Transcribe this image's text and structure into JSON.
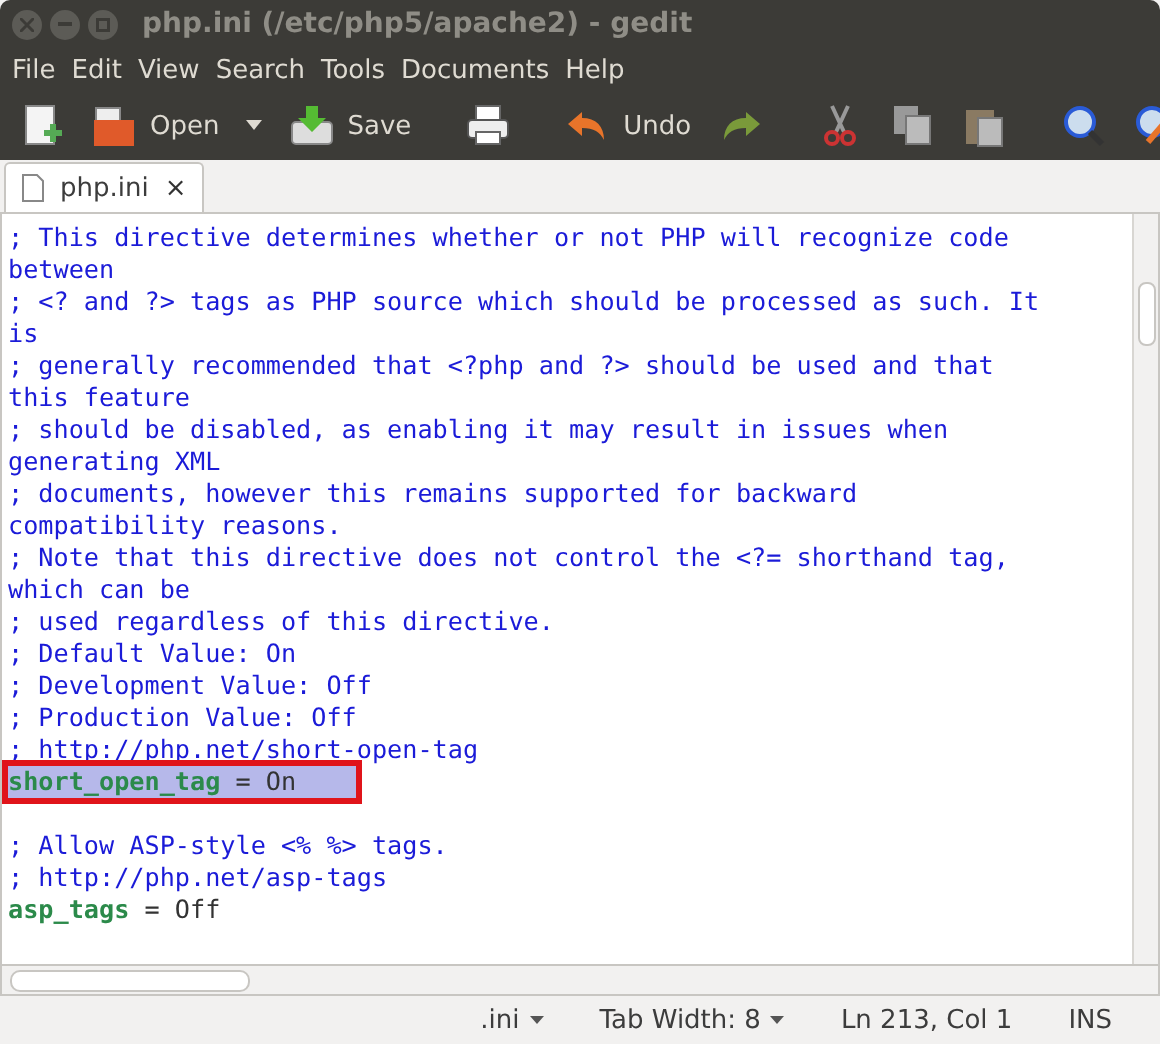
{
  "window": {
    "title": "php.ini (/etc/php5/apache2) - gedit"
  },
  "menu": [
    "File",
    "Edit",
    "View",
    "Search",
    "Tools",
    "Documents",
    "Help"
  ],
  "toolbar": [
    {
      "kind": "new"
    },
    {
      "kind": "open",
      "label": "Open"
    },
    {
      "kind": "dropdown"
    },
    {
      "kind": "save",
      "label": "Save"
    },
    {
      "kind": "separator"
    },
    {
      "kind": "print"
    },
    {
      "kind": "separator"
    },
    {
      "kind": "undo",
      "label": "Undo"
    },
    {
      "kind": "redo"
    },
    {
      "kind": "separator"
    },
    {
      "kind": "cut"
    },
    {
      "kind": "copy"
    },
    {
      "kind": "paste"
    },
    {
      "kind": "separator"
    },
    {
      "kind": "find"
    },
    {
      "kind": "replace"
    }
  ],
  "tabs": [
    {
      "label": "php.ini",
      "selected": true,
      "close": "×"
    }
  ],
  "lines": [
    {
      "kind": "comment",
      "text": "; This directive determines whether or not PHP will recognize code"
    },
    {
      "kind": "comment",
      "text": "between"
    },
    {
      "kind": "comment",
      "text": "; <? and ?> tags as PHP source which should be processed as such. It"
    },
    {
      "kind": "comment",
      "text": "is"
    },
    {
      "kind": "comment",
      "text": "; generally recommended that <?php and ?> should be used and that"
    },
    {
      "kind": "comment",
      "text": "this feature"
    },
    {
      "kind": "comment",
      "text": "; should be disabled, as enabling it may result in issues when"
    },
    {
      "kind": "comment",
      "text": "generating XML"
    },
    {
      "kind": "comment",
      "text": "; documents, however this remains supported for backward"
    },
    {
      "kind": "comment",
      "text": "compatibility reasons."
    },
    {
      "kind": "comment",
      "text": "; Note that this directive does not control the <?= shorthand tag,"
    },
    {
      "kind": "comment",
      "text": "which can be"
    },
    {
      "kind": "comment",
      "text": "; used regardless of this directive."
    },
    {
      "kind": "comment",
      "text": "; Default Value: On"
    },
    {
      "kind": "comment",
      "text": "; Development Value: Off"
    },
    {
      "kind": "comment",
      "text": "; Production Value: Off"
    },
    {
      "kind": "comment",
      "text": "; http://php.net/short-open-tag"
    },
    {
      "kind": "setting",
      "key": "short_open_tag",
      "rest": "= On",
      "selected": true,
      "annotated": true
    },
    {
      "kind": "blank"
    },
    {
      "kind": "comment",
      "text": "; Allow ASP-style <% %> tags."
    },
    {
      "kind": "comment",
      "text": "; http://php.net/asp-tags"
    },
    {
      "kind": "setting",
      "key": "asp_tags",
      "rest": "= Off",
      "selected": false,
      "annotated": false
    }
  ],
  "status_bar": [
    {
      "kind": "dropdown",
      "text": ".ini"
    },
    {
      "kind": "dropdown",
      "text": "Tab Width: 8"
    },
    {
      "kind": "text",
      "text": "Ln 213, Col 1"
    },
    {
      "kind": "text",
      "text": "INS"
    }
  ]
}
